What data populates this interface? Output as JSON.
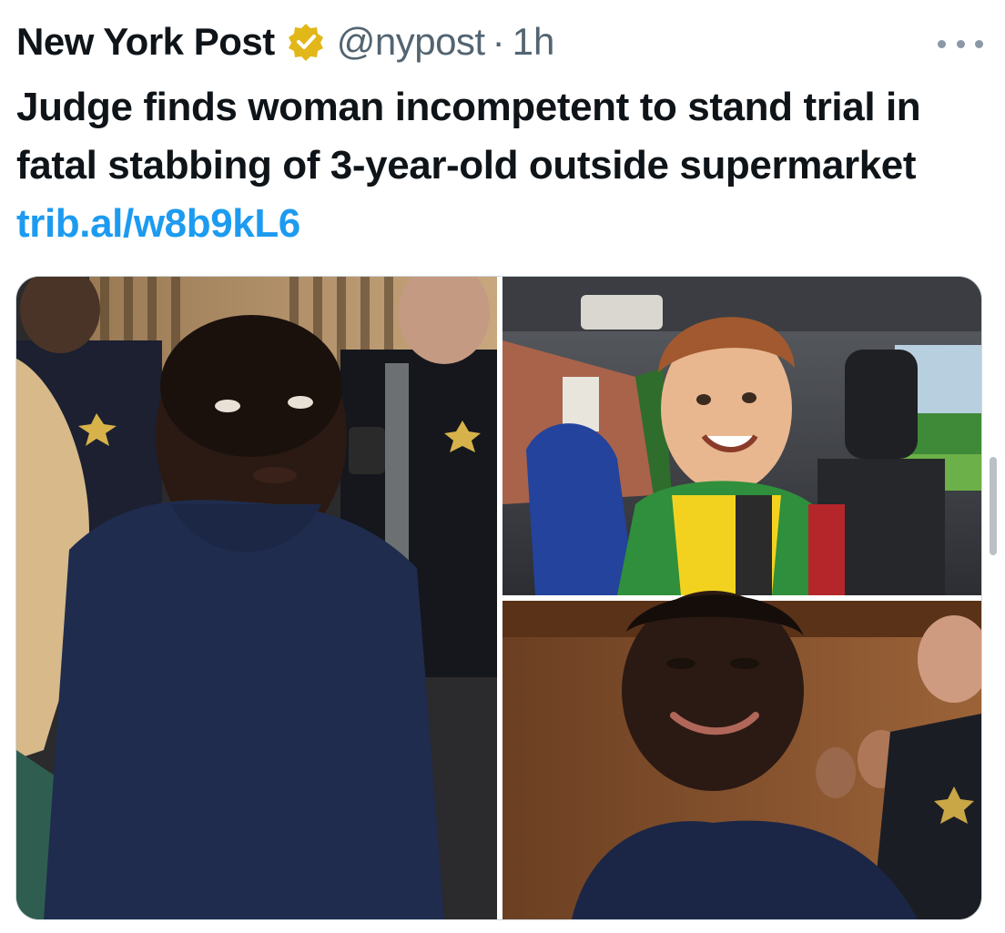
{
  "tweet": {
    "author_name": "New York Post",
    "verified_icon": "gold-verified-badge",
    "handle": "@nypost",
    "separator": "·",
    "timestamp": "1h",
    "more_icon": "more-dots-icon",
    "text": "Judge finds woman incompetent to stand trial in fatal stabbing of 3-year-old outside supermarket",
    "link": "trib.al/w8b9kL6"
  },
  "media": {
    "layout": "three-photo grid",
    "photos": [
      {
        "name": "courtroom-photo-left",
        "description_icon": "photo"
      },
      {
        "name": "child-in-car-photo",
        "description_icon": "photo"
      },
      {
        "name": "courtroom-smile-photo",
        "description_icon": "photo"
      }
    ]
  },
  "colors": {
    "text": "#0f1419",
    "secondary": "#536471",
    "link": "#1d9bf0",
    "verified_gold": "#e2b719"
  }
}
